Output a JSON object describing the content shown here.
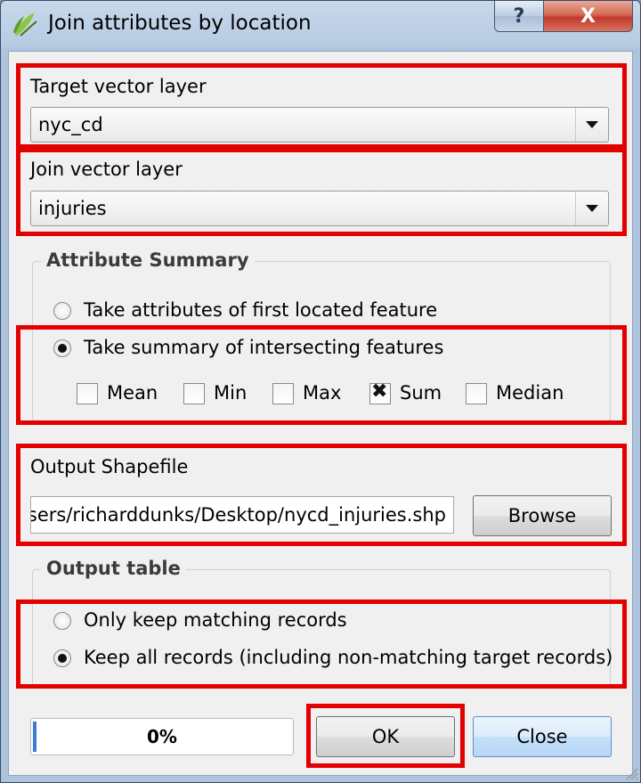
{
  "window": {
    "title": "Join attributes by location",
    "help_glyph": "?",
    "close_glyph": "X",
    "app_icon": "qgis-logo-icon"
  },
  "target_layer": {
    "label": "Target vector layer",
    "value": "nyc_cd"
  },
  "join_layer": {
    "label": "Join vector layer",
    "value": "injuries"
  },
  "attribute_summary": {
    "title": "Attribute Summary",
    "options": [
      {
        "label": "Take attributes of first located feature",
        "selected": false
      },
      {
        "label": "Take summary of intersecting features",
        "selected": true
      }
    ],
    "stats": [
      {
        "label": "Mean",
        "checked": false
      },
      {
        "label": "Min",
        "checked": false
      },
      {
        "label": "Max",
        "checked": false
      },
      {
        "label": "Sum",
        "checked": true
      },
      {
        "label": "Median",
        "checked": false
      }
    ]
  },
  "output": {
    "label": "Output Shapefile",
    "path": "C:\\Users/richarddunks/Desktop/nycd_injuries.shp",
    "browse_label": "Browse"
  },
  "output_table": {
    "title": "Output table",
    "options": [
      {
        "label": "Only keep matching records",
        "selected": false
      },
      {
        "label": "Keep all records (including non-matching target records)",
        "selected": true
      }
    ]
  },
  "footer": {
    "progress": 0,
    "progress_text": "0%",
    "ok_label": "OK",
    "close_label": "Close"
  },
  "colors": {
    "highlight": "#e30000",
    "progress": "#3b7bd4"
  }
}
